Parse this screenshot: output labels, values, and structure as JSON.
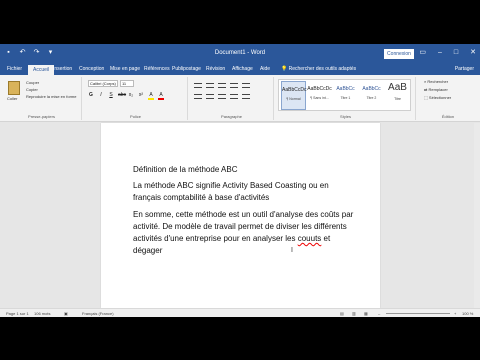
{
  "colors": {
    "accent": "#2b579a",
    "ribbon": "#f3f3f3",
    "spellcheck": "#e00000"
  },
  "titlebar": {
    "title": "Document1 - Word",
    "connect": "Connexion",
    "qat_icons": [
      "save-icon",
      "undo-icon",
      "redo-icon",
      "customize-icon"
    ],
    "window_controls": [
      "ribbon-display-icon",
      "minimize-icon",
      "maximize-icon",
      "close-icon"
    ]
  },
  "tabs": [
    "Fichier",
    "Accueil",
    "Insertion",
    "Conception",
    "Mise en page",
    "Références",
    "Publipostage",
    "Révision",
    "Affichage",
    "Aide"
  ],
  "active_tab": "Accueil",
  "tell_me": "Rechercher des outils adaptés",
  "share": "Partager",
  "ribbon": {
    "clipboard": {
      "paste": "Coller",
      "cut": "Couper",
      "copy": "Copier",
      "format_painter": "Reproduire la mise en forme",
      "label": "Presse-papiers"
    },
    "font": {
      "name": "Calibri (Corps)",
      "size": "11",
      "format_buttons": [
        "G",
        "I",
        "S",
        "abc",
        "x₂",
        "x²",
        "A",
        "A"
      ],
      "label": "Police"
    },
    "paragraph": {
      "label": "Paragraphe"
    },
    "styles": {
      "items": [
        {
          "sample": "AaBbCcDc",
          "name": "¶ Normal"
        },
        {
          "sample": "AaBbCcDc",
          "name": "¶ Sans int..."
        },
        {
          "sample": "AaBbCc",
          "name": "Titre 1"
        },
        {
          "sample": "AaBbCc",
          "name": "Titre 2"
        },
        {
          "sample": "AaB",
          "name": "Titre"
        }
      ],
      "label": "Styles"
    },
    "editing": {
      "find": "Rechercher",
      "replace": "Remplacer",
      "select": "Sélectionner",
      "label": "Édition"
    }
  },
  "document": {
    "p1": "Définition de la méthode ABC",
    "p2": "La méthode ABC signifie Activity Based Coasting ou en français comptabilité à base d'activités",
    "p3_before": "En somme, cette méthode est un outil d'analyse des coûts par activité. De modèle de travail permet de diviser les différents activités d'une entreprise pour en analyser les ",
    "p3_misspelled": "couuts",
    "p3_after": " et dégager"
  },
  "statusbar": {
    "page": "Page 1 sur 1",
    "words": "106 mots",
    "language": "Français (France)",
    "zoom": "100 %"
  }
}
